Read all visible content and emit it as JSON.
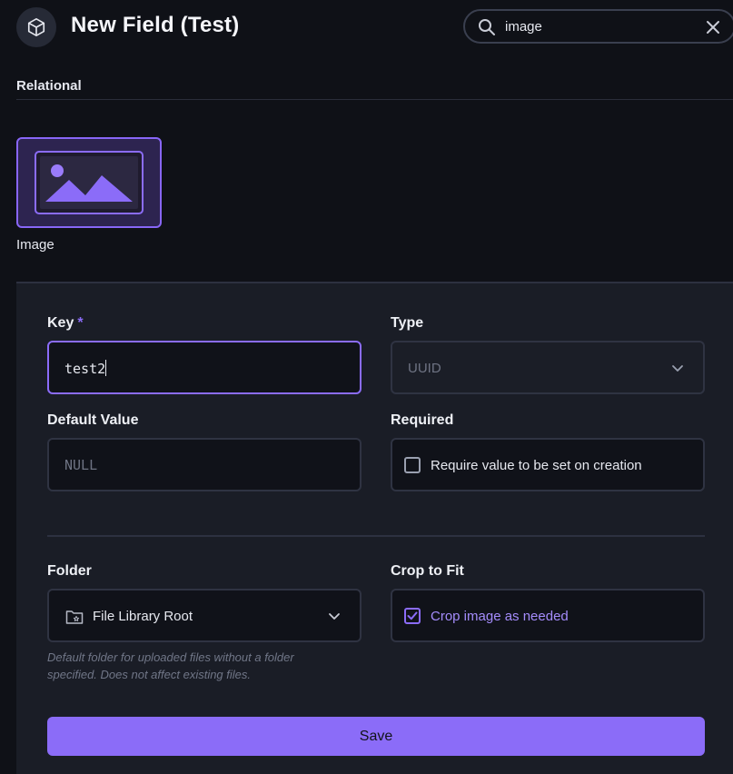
{
  "header": {
    "title": "New Field (Test)",
    "icon": "box-icon"
  },
  "search": {
    "value": "image"
  },
  "interface_section": {
    "label": "Relational",
    "tiles": [
      {
        "label": "Image",
        "icon": "image-icon",
        "selected": true
      }
    ]
  },
  "form": {
    "key": {
      "label": "Key",
      "required_marker": "*",
      "value": "test2"
    },
    "type": {
      "label": "Type",
      "value": "UUID"
    },
    "default_value": {
      "label": "Default Value",
      "placeholder": "NULL"
    },
    "required": {
      "label": "Required",
      "checkbox_label": "Require value to be set on creation",
      "checked": false
    },
    "folder": {
      "label": "Folder",
      "value": "File Library Root",
      "hint": "Default folder for uploaded files without a folder specified. Does not affect existing files."
    },
    "crop": {
      "label": "Crop to Fit",
      "checkbox_label": "Crop image as needed",
      "checked": true
    },
    "save_label": "Save"
  },
  "colors": {
    "accent": "#8b6cf8",
    "background": "#0f1117",
    "panel": "#1a1d26"
  }
}
